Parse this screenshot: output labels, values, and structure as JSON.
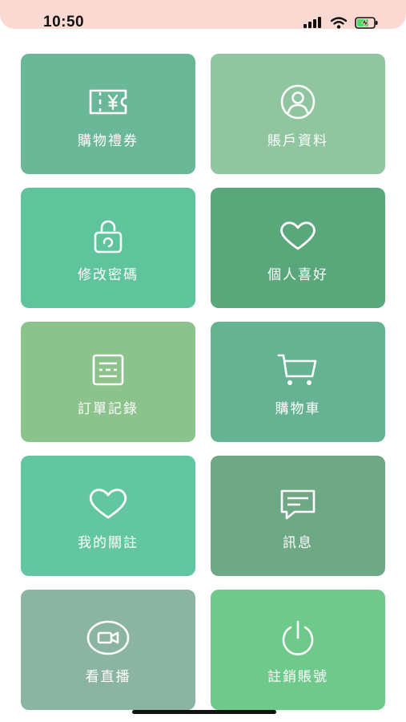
{
  "status_bar": {
    "time": "10:50",
    "background": "#fbd9d3",
    "icons": [
      "signal-icon",
      "wifi-icon",
      "battery-charging-icon"
    ]
  },
  "tiles": [
    {
      "label": "購物禮券",
      "icon": "voucher-icon",
      "color": "#6ab898"
    },
    {
      "label": "賬戶資料",
      "icon": "user-icon",
      "color": "#8fc69f"
    },
    {
      "label": "修改密碼",
      "icon": "lock-icon",
      "color": "#5fc49b"
    },
    {
      "label": "個人喜好",
      "icon": "heart-icon",
      "color": "#5aa77b"
    },
    {
      "label": "訂單記錄",
      "icon": "document-icon",
      "color": "#8cc38c"
    },
    {
      "label": "購物車",
      "icon": "cart-icon",
      "color": "#66b393"
    },
    {
      "label": "我的關註",
      "icon": "heart-icon",
      "color": "#62c7a1"
    },
    {
      "label": "訊息",
      "icon": "message-icon",
      "color": "#6fa884"
    },
    {
      "label": "看直播",
      "icon": "video-camera-icon",
      "color": "#8bb5a2"
    },
    {
      "label": "註銷賬號",
      "icon": "power-icon",
      "color": "#6ec98a"
    }
  ]
}
